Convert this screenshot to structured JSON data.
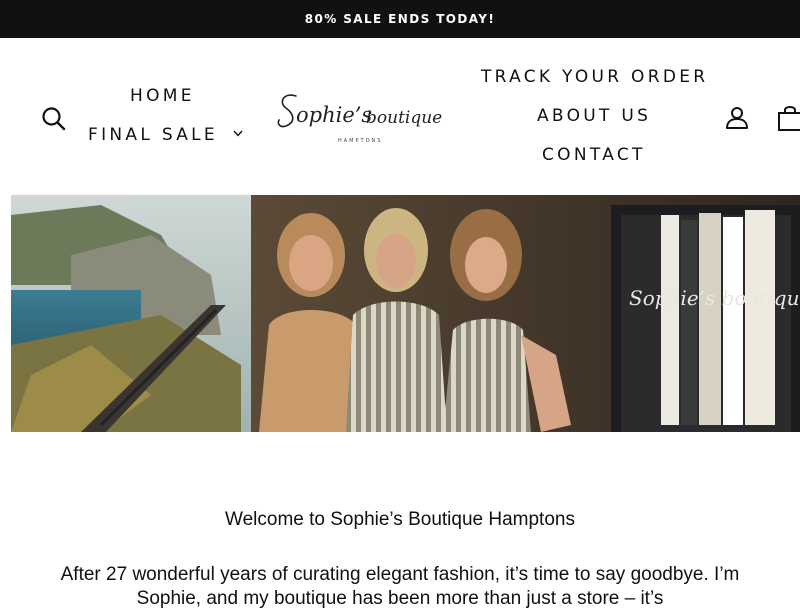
{
  "announcement": {
    "text": "80% SALE ENDS TODAY!"
  },
  "header": {
    "nav_left": {
      "home": "HOME",
      "final_sale": "FINAL SALE"
    },
    "nav_right": {
      "track_order": "TRACK YOUR ORDER",
      "about": "ABOUT US",
      "contact": "CONTACT"
    },
    "logo": {
      "name": "Sophie's boutique",
      "sub": "HAMPTONS"
    },
    "icons": [
      "search-icon",
      "chevron-down-icon",
      "user-icon",
      "cart-icon"
    ]
  },
  "hero": {
    "overlay_logo": "Sophie's boutique"
  },
  "content": {
    "heading": "Welcome to Sophie’s Boutique Hamptons",
    "paragraph": "After 27 wonderful years of curating elegant fashion, it’s time to say goodbye. I’m Sophie, and my boutique has been more than just a store – it’s"
  },
  "colors": {
    "announcement_bg": "#111111",
    "text": "#111111",
    "background": "#ffffff"
  }
}
